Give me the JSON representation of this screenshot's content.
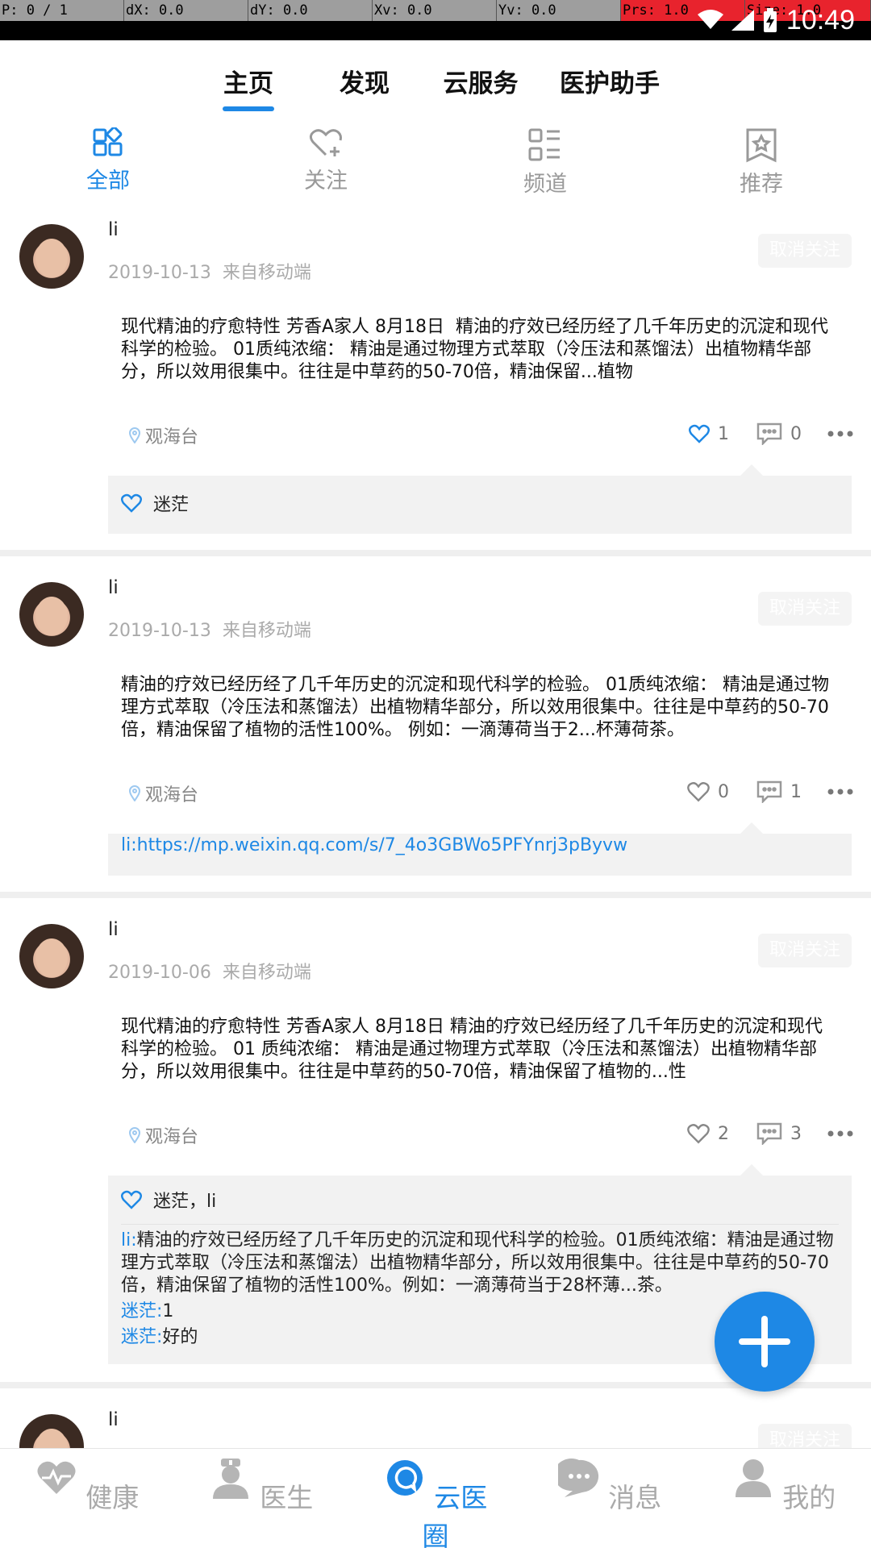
{
  "debug_bar": {
    "p": "P: 0 / 1",
    "dx": "dX: 0.0",
    "dy": "dY: 0.0",
    "xv": "Xv: 0.0",
    "yv": "Yv: 0.0",
    "prs": "Prs: 1.0",
    "size": "Size: 1.0"
  },
  "status_bar": {
    "time": "10:49"
  },
  "top_tabs": [
    {
      "label": "主页",
      "active": true
    },
    {
      "label": "发现",
      "active": false
    },
    {
      "label": "云服务",
      "active": false
    },
    {
      "label": "医护助手",
      "active": false
    }
  ],
  "sub_tabs": [
    {
      "label": "全部",
      "icon": "grid-icon",
      "active": true
    },
    {
      "label": "关注",
      "icon": "heart-plus-icon",
      "active": false
    },
    {
      "label": "频道",
      "icon": "list-icon",
      "active": false
    },
    {
      "label": "推荐",
      "icon": "star-badge-icon",
      "active": false
    }
  ],
  "posts": [
    {
      "username": "li",
      "date": "2019-10-13",
      "source": "来自移动端",
      "follow_label": "取消关注",
      "content": "现代精油的疗愈特性 芳香A家人 8月18日 ￼ ￼精油的疗效已经历经了几千年历史的沉淀和现代科学的检验。 01质纯浓缩： 精油是通过物理方式萃取（冷压法和蒸馏法）出植物精华部分，所以效用很集中。往往是中草药的50-70倍，精油保留...植物",
      "location": "观海台",
      "likes": "1",
      "comments": "0",
      "liked_by": "迷茫"
    },
    {
      "username": "li",
      "date": "2019-10-13",
      "source": "来自移动端",
      "follow_label": "取消关注",
      "content": "精油的疗效已经历经了几千年历史的沉淀和现代科学的检验。 01质纯浓缩： 精油是通过物理方式萃取（冷压法和蒸馏法）出植物精华部分，所以效用很集中。往往是中草药的50-70倍，精油保留了植物的活性100%。 例如：一滴薄荷当于2...杯薄荷茶。",
      "location": "观海台",
      "likes": "0",
      "comments": "1",
      "link": "li:https://mp.weixin.qq.com/s/7_4o3GBWo5PFYnrj3pByvw"
    },
    {
      "username": "li",
      "date": "2019-10-06",
      "source": "来自移动端",
      "follow_label": "取消关注",
      "content": "现代精油的疗愈特性 芳香A家人 8月18日 精油的疗效已经历经了几千年历史的沉淀和现代科学的检验。 01 质纯浓缩： 精油是通过物理方式萃取（冷压法和蒸馏法）出植物精华部分，所以效用很集中。往往是中草药的50-70倍，精油保留了植物的...性",
      "location": "观海台",
      "likes": "2",
      "comments": "3",
      "liked_by": "迷茫，li",
      "comment_list": [
        {
          "who": "li:",
          "text": "精油的疗效已经历经了几千年历史的沉淀和现代科学的检验。01质纯浓缩：精油是通过物理方式萃取（冷压法和蒸馏法）出植物精华部分，所以效用很集中。往往是中草药的50-70倍，精油保留了植物的活性100%。例如：一滴薄荷当于28杯薄...茶。"
        },
        {
          "who": "迷茫:",
          "text": "1"
        },
        {
          "who": "迷茫:",
          "text": "好的"
        }
      ]
    },
    {
      "username": "li",
      "follow_label": "取消关注"
    }
  ],
  "bottom_nav": [
    {
      "label": "健康",
      "icon": "heart-pulse-icon",
      "active": false
    },
    {
      "label": "医生",
      "icon": "doctor-icon",
      "active": false
    },
    {
      "label": "云医圈",
      "icon": "chat-circle-icon",
      "active": true
    },
    {
      "label": "消息",
      "icon": "message-bubble-icon",
      "active": false
    },
    {
      "label": "我的",
      "icon": "user-icon",
      "active": false
    }
  ],
  "colors": {
    "accent": "#1e88e5",
    "debug_red": "#e8232d"
  }
}
